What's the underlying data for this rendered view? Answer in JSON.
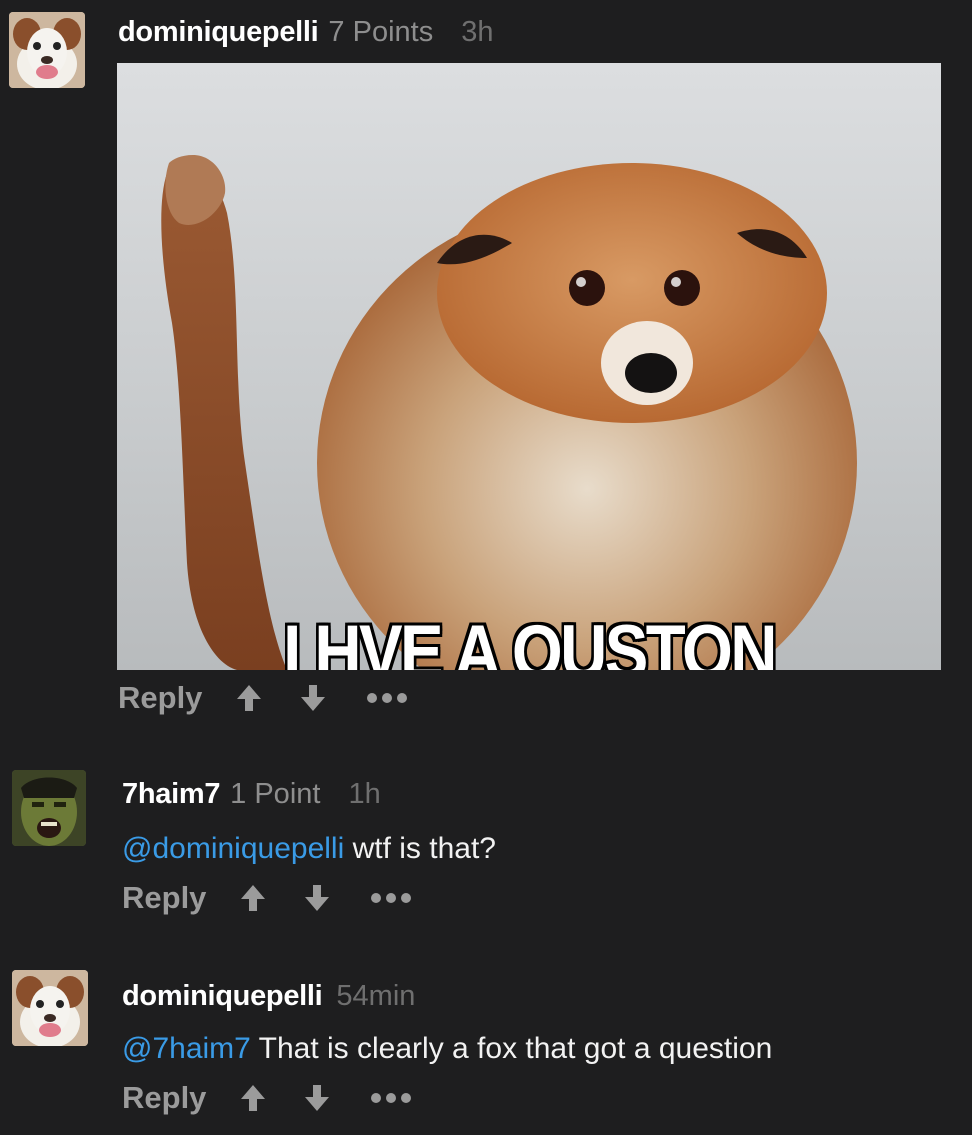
{
  "comments": [
    {
      "username": "dominiquepelli",
      "points": "7 Points",
      "time": "3h",
      "meme_caption": "I HVE A QUSTON",
      "actions": {
        "reply": "Reply"
      }
    },
    {
      "username": "7haim7",
      "points": "1 Point",
      "time": "1h",
      "mention": "@dominiquepelli",
      "text": " wtf is that?",
      "actions": {
        "reply": "Reply"
      }
    },
    {
      "username": "dominiquepelli",
      "time": "54min",
      "mention": "@7haim7",
      "text": " That is clearly a fox that got a question",
      "actions": {
        "reply": "Reply"
      }
    }
  ],
  "icons": {
    "upvote": "arrow-up-icon",
    "downvote": "arrow-down-icon",
    "more": "more-options-icon"
  },
  "colors": {
    "background": "#1e1e1f",
    "mention": "#3a9be6",
    "username": "#ffffff",
    "muted": "#8e8e8e"
  }
}
